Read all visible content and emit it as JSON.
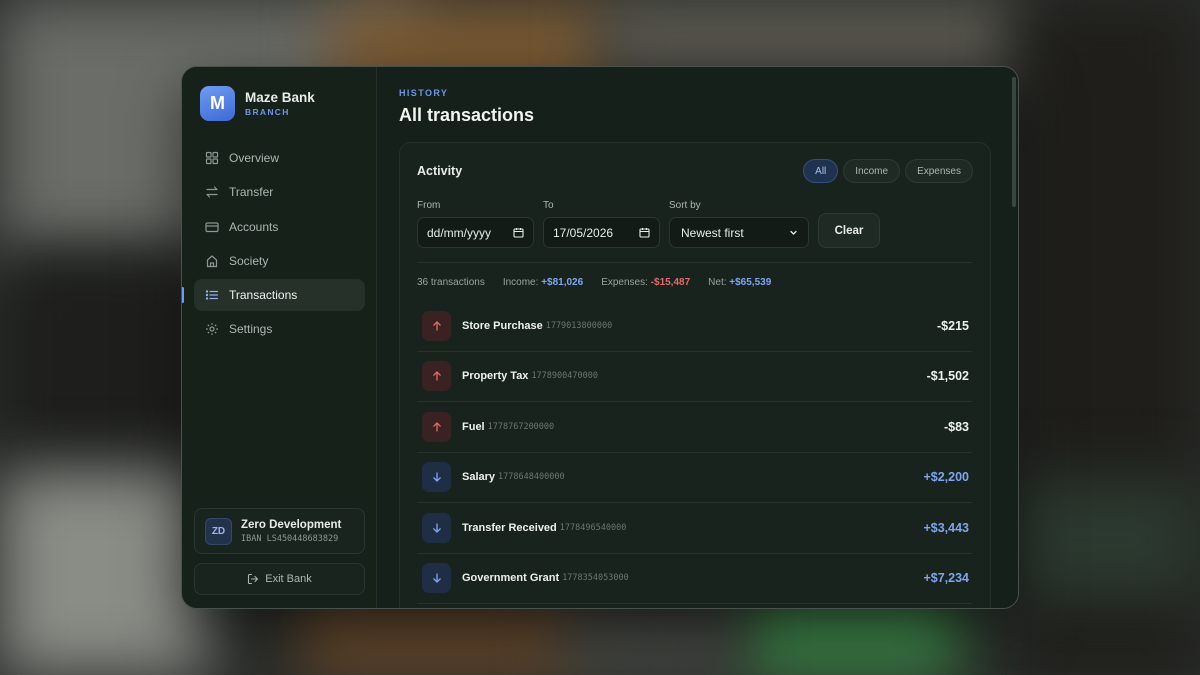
{
  "brand": {
    "initial": "M",
    "name": "Maze Bank",
    "subtitle": "BRANCH"
  },
  "nav": [
    {
      "label": "Overview",
      "icon": "grid-icon",
      "active": false
    },
    {
      "label": "Transfer",
      "icon": "arrows-exchange-icon",
      "active": false
    },
    {
      "label": "Accounts",
      "icon": "card-icon",
      "active": false
    },
    {
      "label": "Society",
      "icon": "bank-building-icon",
      "active": false
    },
    {
      "label": "Transactions",
      "icon": "list-icon",
      "active": true
    },
    {
      "label": "Settings",
      "icon": "gear-icon",
      "active": false
    }
  ],
  "user": {
    "initials": "ZD",
    "name": "Zero Development",
    "iban": "IBAN LS450448683829"
  },
  "exit_label": "Exit Bank",
  "header": {
    "eyebrow": "HISTORY",
    "title": "All transactions"
  },
  "panel": {
    "title": "Activity",
    "filters": [
      {
        "label": "All",
        "active": true
      },
      {
        "label": "Income",
        "active": false
      },
      {
        "label": "Expenses",
        "active": false
      }
    ],
    "from": {
      "label": "From",
      "value": "dd/mm/yyyy"
    },
    "to": {
      "label": "To",
      "value": "17/05/2026"
    },
    "sort": {
      "label": "Sort by",
      "value": "Newest first"
    },
    "clear_label": "Clear",
    "summary": {
      "count": "36 transactions",
      "income_label": "Income:",
      "income_value": "+$81,026",
      "expenses_label": "Expenses:",
      "expenses_value": "-$15,487",
      "net_label": "Net:",
      "net_value": "+$65,539"
    },
    "transactions": [
      {
        "name": "Store Purchase",
        "id": "1779013800000",
        "amount": "-$215",
        "direction": "out"
      },
      {
        "name": "Property Tax",
        "id": "1778900470000",
        "amount": "-$1,502",
        "direction": "out"
      },
      {
        "name": "Fuel",
        "id": "1778767200000",
        "amount": "-$83",
        "direction": "out"
      },
      {
        "name": "Salary",
        "id": "1778648400000",
        "amount": "+$2,200",
        "direction": "in"
      },
      {
        "name": "Transfer Received",
        "id": "1778496540000",
        "amount": "+$3,443",
        "direction": "in"
      },
      {
        "name": "Government Grant",
        "id": "1778354053000",
        "amount": "+$7,234",
        "direction": "in"
      }
    ]
  },
  "colors": {
    "accent": "#6f9cf2",
    "income": "#7ea6f0",
    "expense": "#e26b6b",
    "background": "#142019"
  }
}
